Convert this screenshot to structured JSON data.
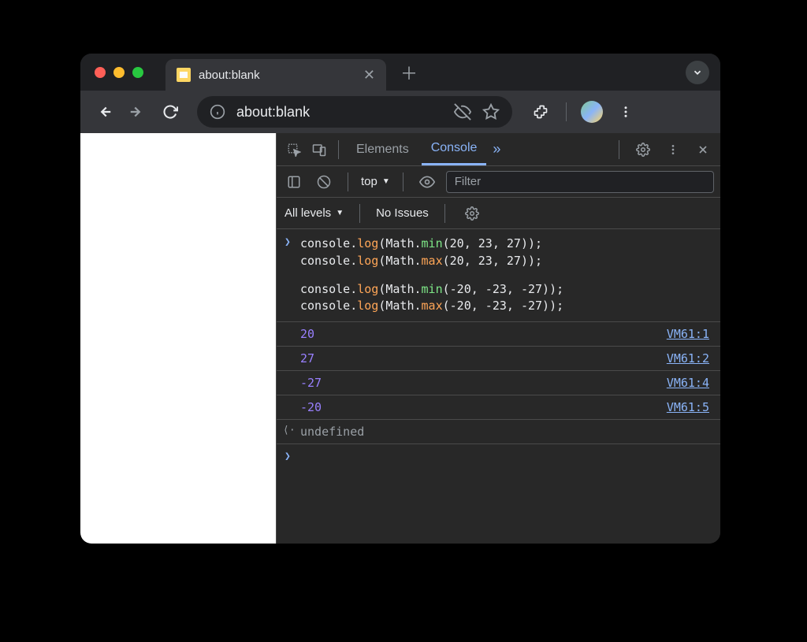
{
  "tab": {
    "title": "about:blank"
  },
  "url": "about:blank",
  "devtools": {
    "tabs": {
      "elements": "Elements",
      "console": "Console"
    },
    "toolbar": {
      "context": "top",
      "filter_placeholder": "Filter",
      "levels": "All levels",
      "issues": "No Issues"
    },
    "code": {
      "l1": {
        "pre": "console.",
        "log": "log",
        "obj": "(Math.",
        "fn": "min",
        "args": "(20, 23, 27));"
      },
      "l2": {
        "pre": "console.",
        "log": "log",
        "obj": "(Math.",
        "fn": "max",
        "args": "(20, 23, 27));"
      },
      "l3": {
        "pre": "console.",
        "log": "log",
        "obj": "(Math.",
        "fn": "min",
        "args": "(-20, -23, -27));"
      },
      "l4": {
        "pre": "console.",
        "log": "log",
        "obj": "(Math.",
        "fn": "max",
        "args": "(-20, -23, -27));"
      }
    },
    "outputs": [
      {
        "value": "20",
        "source": "VM61:1"
      },
      {
        "value": "27",
        "source": "VM61:2"
      },
      {
        "value": "-27",
        "source": "VM61:4"
      },
      {
        "value": "-20",
        "source": "VM61:5"
      }
    ],
    "return_value": "undefined"
  }
}
